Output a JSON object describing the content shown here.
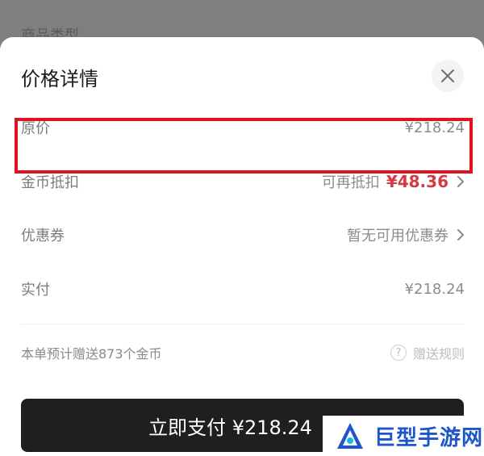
{
  "background": {
    "label": "商品类型"
  },
  "sheet": {
    "title": "价格详情",
    "rows": {
      "original": {
        "label": "原价",
        "value": "¥218.24"
      },
      "coins": {
        "label": "金币抵扣",
        "hint": "可再抵扣",
        "value": "¥48.36"
      },
      "coupon": {
        "label": "优惠券",
        "value": "暂无可用优惠券"
      },
      "actual": {
        "label": "实付",
        "value": "¥218.24"
      }
    },
    "gift": {
      "text": "本单预计赠送873个金币",
      "rules_label": "赠送规则",
      "rules_icon": "?"
    },
    "pay_button": "立即支付 ¥218.24"
  },
  "watermark": {
    "text": "巨型手游网"
  },
  "colors": {
    "accent_red": "#d43a3f",
    "highlight_border": "#e0121f",
    "pay_button_bg": "#1f1f1f",
    "watermark_blue": "#1d56c8"
  }
}
